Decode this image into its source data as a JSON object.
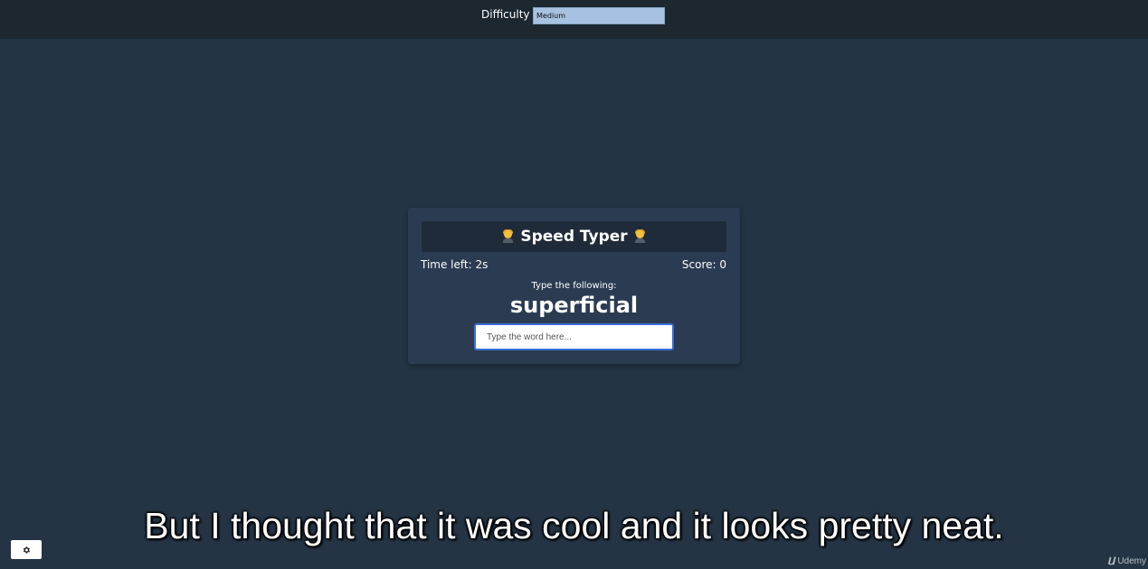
{
  "header": {
    "difficulty_label": "Difficulty",
    "difficulty_selected": "Medium"
  },
  "game": {
    "title": "Speed Typer",
    "time_left": "Time left: 2s",
    "score": "Score: 0",
    "prompt": "Type the following:",
    "word": "superficial",
    "input_placeholder": "Type the word here...",
    "input_value": ""
  },
  "icons": {
    "title_left": "person-typing-emoji-icon",
    "title_right": "person-typing-emoji-icon",
    "settings": "gear-icon"
  },
  "colors": {
    "page_bg": "#243444",
    "topbar_bg": "#1c2730",
    "card_bg": "#2b3c52",
    "card_header_bg": "#1f2b38",
    "select_bg": "#a7c2e0",
    "input_border": "#3b6fd8"
  },
  "overlay": {
    "subtitle": "But I thought that it was cool and it looks pretty neat.",
    "watermark": "Udemy"
  }
}
